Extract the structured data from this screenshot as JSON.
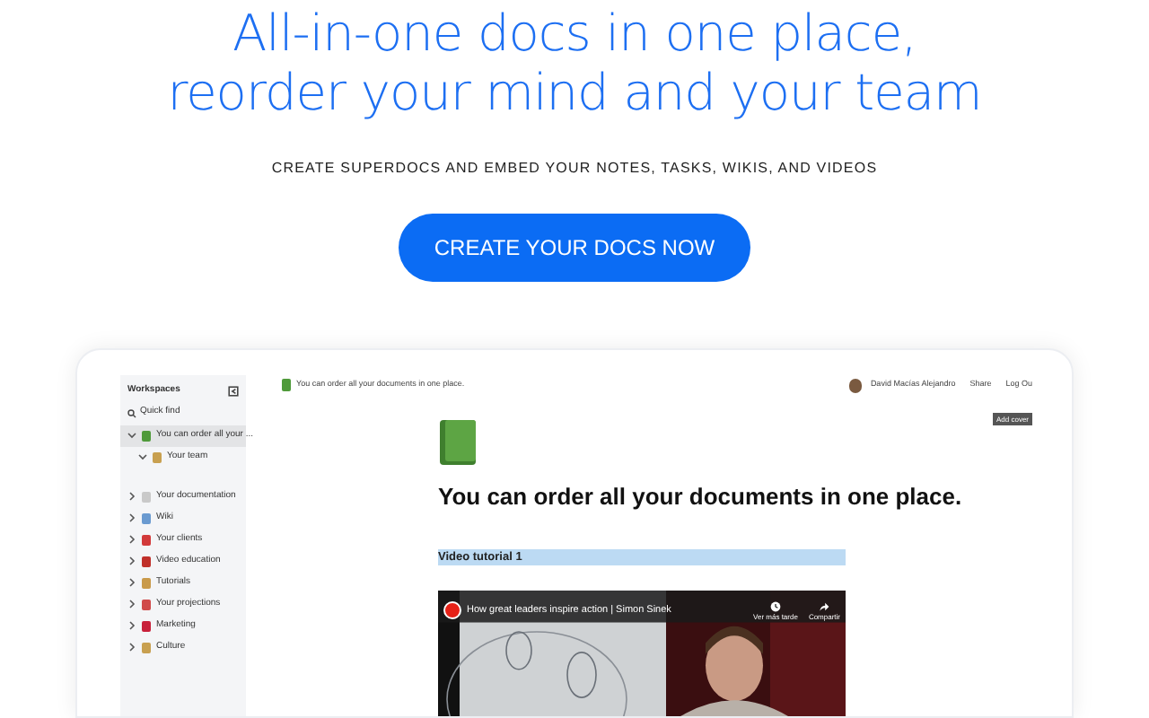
{
  "hero": {
    "headline_lines": [
      "All-in-one docs in one place,",
      "reorder your mind and your team"
    ],
    "subtitle": "CREATE SUPERDOCS AND EMBED YOUR NOTES, TASKS, WIKIS, AND VIDEOS",
    "cta": "CREATE YOUR DOCS NOW"
  },
  "app": {
    "sidebar": {
      "title": "Workspaces",
      "quick_find": "Quick find",
      "items": [
        {
          "label": "You can order all your ...",
          "selected": true,
          "expanded": true,
          "children": [
            {
              "label": "Your team",
              "selected": false,
              "expanded": true
            }
          ]
        },
        {
          "label": "Your documentation",
          "selected": false,
          "expanded": false
        },
        {
          "label": "Wiki",
          "selected": false,
          "expanded": false
        },
        {
          "label": "Your clients",
          "selected": false,
          "expanded": false
        },
        {
          "label": "Video education",
          "selected": false,
          "expanded": false
        },
        {
          "label": "Tutorials",
          "selected": false,
          "expanded": false
        },
        {
          "label": "Your projections",
          "selected": false,
          "expanded": false
        },
        {
          "label": "Marketing",
          "selected": false,
          "expanded": false
        },
        {
          "label": "Culture",
          "selected": false,
          "expanded": false
        }
      ]
    },
    "breadcrumb": "You can order all your documents in one place.",
    "user": "David Macías Alejandro",
    "share": "Share",
    "logout": "Log Ou",
    "add_cover": "Add cover",
    "doc_title": "You can order all your documents in one place.",
    "section_heading": "Video tutorial 1",
    "video": {
      "title": "How great leaders inspire action | Simon Sinek",
      "watch_later": "Ver más tarde",
      "share": "Compartir"
    }
  }
}
